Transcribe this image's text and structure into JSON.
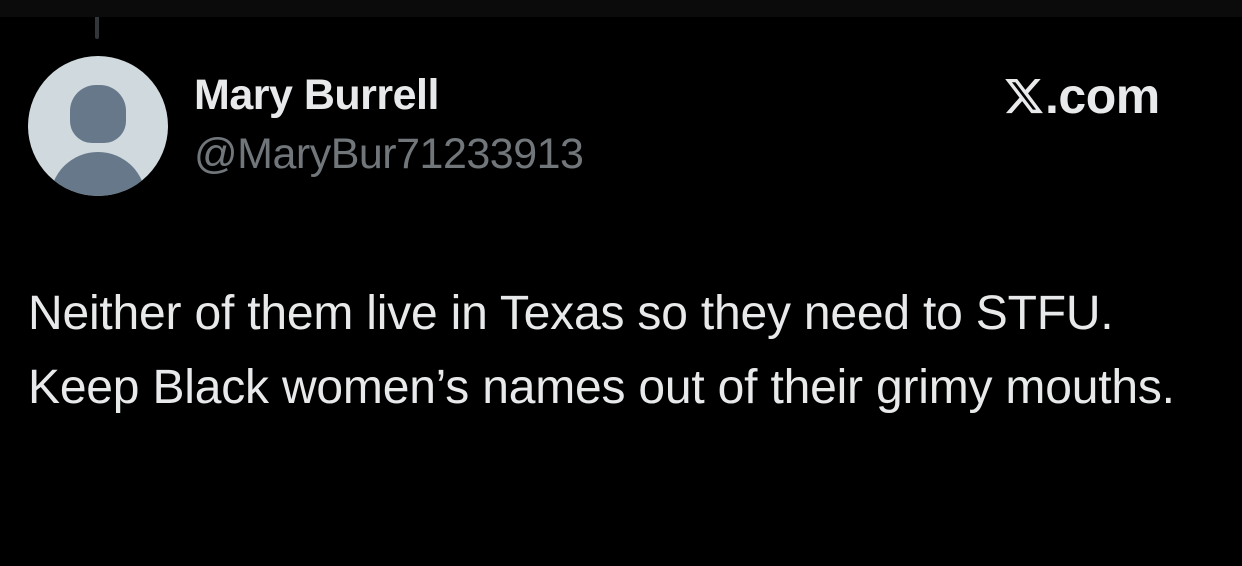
{
  "author": {
    "display_name": "Mary Burrell",
    "handle": "@MaryBur71233913",
    "avatar_icon": "default-profile-icon"
  },
  "brand": {
    "logo_icon": "x-logo-icon",
    "text": ".com"
  },
  "tweet": {
    "text": "Neither of them live in Texas so they need to STFU. Keep Black women’s names out of their grimy mouths."
  },
  "colors": {
    "background": "#000000",
    "primary_text": "#e7e9ea",
    "secondary_text": "#71767b",
    "avatar_bg": "#cfd9de",
    "avatar_fg": "#66788a"
  }
}
